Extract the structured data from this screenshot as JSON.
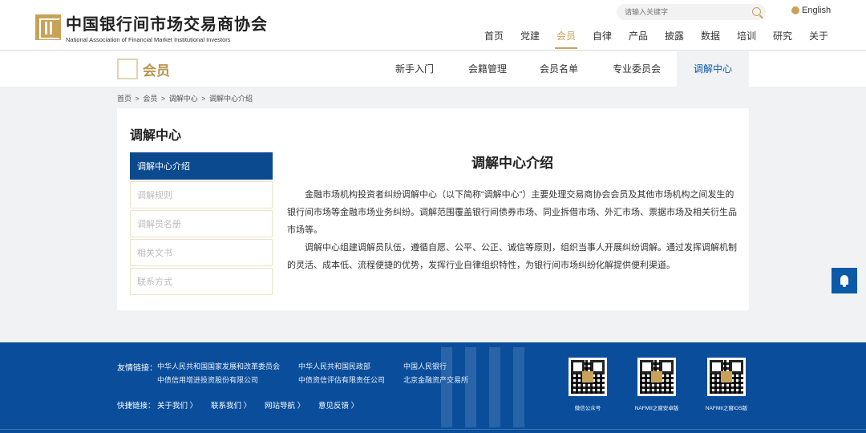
{
  "header": {
    "logo_cn": "中国银行间市场交易商协会",
    "logo_en": "National Association of Financial Market Institutional Investors",
    "search_placeholder": "请输入关键字",
    "lang": "English",
    "nav": [
      "首页",
      "党建",
      "会员",
      "自律",
      "产品",
      "披露",
      "数据",
      "培训",
      "研究",
      "关于"
    ],
    "active_nav": "会员"
  },
  "section": {
    "title": "会员",
    "tabs": [
      "新手入门",
      "会籍管理",
      "会员名单",
      "专业委员会",
      "调解中心"
    ],
    "active_tab": "调解中心"
  },
  "breadcrumb": [
    "首页",
    ">",
    "会员",
    ">",
    "调解中心",
    ">",
    "调解中心介绍"
  ],
  "sidebar": {
    "title": "调解中心",
    "items": [
      "调解中心介绍",
      "调解规则",
      "调解员名册",
      "相关文书",
      "联系方式"
    ]
  },
  "content": {
    "title": "调解中心介绍",
    "paragraphs": [
      "金融市场机构投资者纠纷调解中心（以下简称“调解中心”）主要处理交易商协会会员及其他市场机构之间发生的银行间市场等金融市场业务纠纷。调解范围覆盖银行间债券市场、同业拆借市场、外汇市场、票据市场及相关衍生品市场等。",
      "调解中心组建调解员队伍，遵循自愿、公平、公正、诚信等原则，组织当事人开展纠纷调解。通过发挥调解机制的灵活、成本低、流程便捷的优势，发挥行业自律组织特性，为银行间市场纠纷化解提供便利渠道。"
    ]
  },
  "footer": {
    "links_label": "友情链接：",
    "links": [
      "中华人民共和国国家发展和改革委员会",
      "中华人民共和国民政部",
      "中国人民银行",
      "中债信用增进投资股份有限公司",
      "中债资信评估有限责任公司",
      "北京金融资产交易所"
    ],
    "quick_label": "快捷链接：",
    "quick": [
      "关于我们 〉",
      "联系我们 〉",
      "网站导航 〉",
      "意见反馈 〉"
    ],
    "qr_captions": [
      "微信公众号",
      "NAFMII之窗安卓版",
      "NAFMII之窗iOS版"
    ]
  },
  "colors": {
    "brand_gold": "#c9a25a",
    "brand_blue": "#0b4a8f",
    "footer_blue": "#0a4e9b"
  }
}
